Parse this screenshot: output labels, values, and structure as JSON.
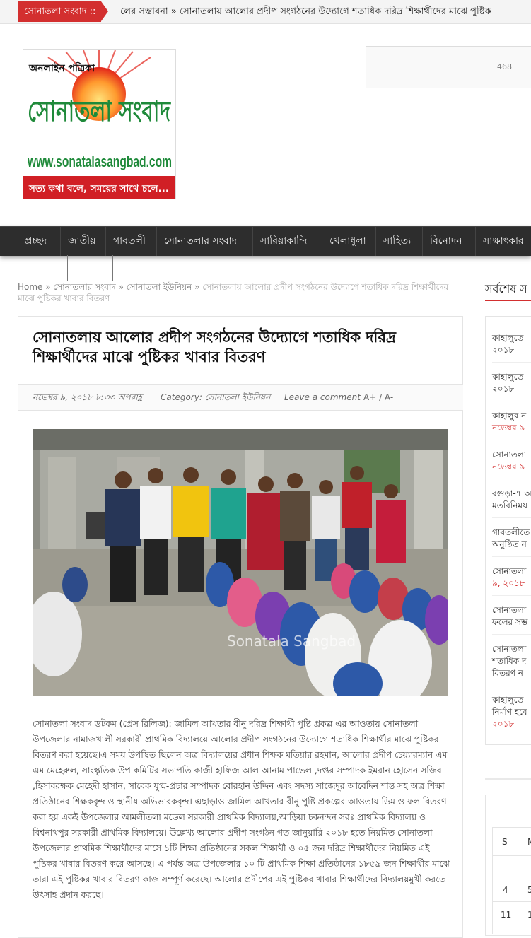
{
  "ticker": {
    "label": "সোনাতলা সংবাদ ::",
    "text": "লের সম্ভাবনা   » সোনাতলায় আলোর প্রদীপ সংগঠনের উদ্যোগে শতাধিক দরিদ্র শিক্ষার্থীদের মাঝে পুষ্টিক"
  },
  "logo": {
    "top_text": "অনলাইন পত্রিকা",
    "name": "সোনাতলা সংবাদ",
    "url": "www.sonatalasangbad.com",
    "tagline": "সত্য কথা বলে, সময়ের সাথে চলে..."
  },
  "ad": {
    "text": "468"
  },
  "nav": {
    "items": [
      "প্রচ্ছদ",
      "জাতীয়",
      "গাবতলী",
      "সোনাতলার সংবাদ",
      "সারিয়াকান্দি",
      "খেলাধুলা",
      "সাহিত্য",
      "বিনোদন",
      "সাক্ষাৎকার"
    ]
  },
  "breadcrumb": {
    "home": "Home",
    "sep": " » ",
    "cat1": "সোনাতলার সংবাদ",
    "cat2": "সোনাতলা ইউনিয়ন",
    "current": "সোনাতলায় আলোর প্রদীপ সংগঠনের উদ্যোগে শতাধিক দরিদ্র শিক্ষার্থীদের মাঝে পুষ্টিকর খাবার বিতরণ"
  },
  "post": {
    "title": "সোনাতলায় আলোর প্রদীপ সংগঠনের উদ্যোগে শতাধিক দরিদ্র শিক্ষার্থীদের মাঝে পুষ্টিকর খাবার বিতরণ",
    "date": "নভেম্বর ৯, ২০১৮ ৮:৩৩ অপরাহ্ণ",
    "category": "Category: সোনাতলা ইউনিয়ন",
    "comment": "Leave a comment",
    "font_size": "A+ / A-",
    "watermark": "Sonatala Sangbad",
    "body": "সোনাতলা সংবাদ ডটকম (প্রেস রিলিজ): জামিল আখতার বীনু দরিদ্র শিক্ষার্থী পুষ্টি প্রকল্প এর আওতায় সোনাতলা উপজেলার নামাজখালী সরকারী প্রাথমিক বিদ্যালয়ে আলোর প্রদীপ সংগঠনের উদ্যোগে শতাধিক শিক্ষার্থীর মাঝে পুষ্টিকর বিতরণ করা হয়েছে।এ সময় উপস্থিত ছিলেন অত্র বিদ্যালয়ের প্রধান শিক্ষক মতিয়ার রহমান, আলোর প্রদীপ চেয়্যারম্যান এম এম মেহেরুল, সাংস্কৃতিক উপ কমিটির সভাপতি কাজী হাফিজ আল আনাম পাভেল ,দপ্তর সম্পাদক ইমরান হোসেন সজিব ,হিসাবরক্ষক মেহেদী হাসান, সাবেক যুগ্ম-প্রচার সম্পাদক বোরহান উদ্দিন এবং সদস্য সাজেদুর আবেদিন শান্ত সহ অত্র শিক্ষা প্রতিষ্ঠানের শিক্ষকবৃন্দ ও স্থানীয় অভিভাবকবৃন্দ। এছাড়াও জামিল আখতার বীনু পুষ্টি প্রকল্পের আওতায় ডিম ও ফল বিতরণ করা হয় একই উপজেলার আমলীতলা মডেল সরকারী প্রাথমিক বিদ্যালয়,আড়িয়া চকনন্দন সরঃ প্রাথমিক বিদ্যালয় ও বিশ্বনাথপুর সরকারী প্রাথমিক বিদ্যালয়ে। উল্লেখ্য আলোর প্রদীপ সংগঠন গত জানুয়ারি ২০১৮ হতে নিয়মিত সোনাতলা উপজেলার প্রাথমিক শিক্ষার্থীদের মাসে ১টি শিক্ষা প্রতিষ্ঠানের সকল শিক্ষার্থী ও ০৫ জন দরিদ্র শিক্ষার্থীদের নিয়মিত এই পুষ্টিকর খাবার বিতরণ করে আসছে। এ পর্যন্ত অত্র উপজেলার ১০ টি প্রাথমিক শিক্ষা প্রতিষ্ঠানের ১৮৫৯ জন শিক্ষার্থীর মাঝে তারা এই পুষ্টিকর খাবার বিতরণ কাজ সম্পূর্ণ করেছে। আলোর প্রদীপের এই পুষ্টিকর খাবার শিক্ষার্থীদের বিদ্যালয়মুখী করতে উৎসাহ প্রদান করছে।"
  },
  "sidebar": {
    "title": "সর্বশেষ স",
    "items": [
      {
        "l1": "কাহালুতে",
        "l2": "২০১৮",
        "red": false
      },
      {
        "l1": "কাহালুতে",
        "l2": "২০১৮",
        "red": false
      },
      {
        "l1": "কাহালুর ন",
        "l2": "নভেম্বর ৯",
        "red": true
      },
      {
        "l1": "সোনাতলা",
        "l2": "নভেম্বর ৯",
        "red": true
      },
      {
        "l1": "বগুড়া-৭ অ",
        "l2": "মতবিনিময়",
        "red": false
      },
      {
        "l1": "গাবতলীতে",
        "l2": "অনুষ্ঠিত ন",
        "red": false
      },
      {
        "l1": "সোনাতলা",
        "l2": "৯, ২০১৮",
        "red": false
      },
      {
        "l1": "সোনাতলা",
        "l2": "ফলের সম্ভ",
        "red": false
      },
      {
        "l1": "সোনাতলা",
        "l2": "শতাধিক দ",
        "l3": "বিতরণ ন",
        "red": false
      },
      {
        "l1": "কাহালুতে",
        "l2": "নির্মাণ হবে",
        "l3": "২০১৮",
        "red": false
      }
    ]
  },
  "calendar": {
    "header": [
      "S",
      "M"
    ],
    "row1": [
      "4",
      "5"
    ],
    "row2": [
      "11",
      "1"
    ]
  }
}
